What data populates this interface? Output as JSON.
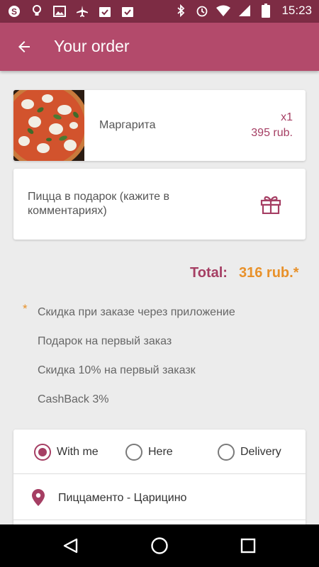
{
  "status_bar": {
    "time": "15:23",
    "left_icons": [
      "skype-icon",
      "lightbulb-icon",
      "image-icon",
      "airplane-icon",
      "checklist-icon",
      "checklist-icon"
    ],
    "right_icons": [
      "bluetooth-icon",
      "alarm-icon",
      "wifi-icon",
      "signal-icon",
      "battery-icon"
    ]
  },
  "app_bar": {
    "title": "Your order",
    "back_icon": "arrow-left-icon",
    "background": "#b34a6b"
  },
  "order_item": {
    "name": "Маргарита",
    "quantity": "x1",
    "price": "395 rub."
  },
  "gift": {
    "text": "Пицца в подарок (кажите в комментариях)",
    "icon": "gift-icon"
  },
  "total": {
    "label": "Total:",
    "value": "316 rub.*"
  },
  "notes": {
    "asterisk": "*",
    "items": [
      "Скидка при заказе через приложение",
      "Подарок на первый заказ",
      "Скидка 10% на первый заказк",
      "CashBack 3%"
    ]
  },
  "delivery": {
    "options": [
      {
        "label": "With me",
        "selected": true
      },
      {
        "label": "Here",
        "selected": false
      },
      {
        "label": "Delivery",
        "selected": false
      }
    ],
    "location": "Пиццаменто - Царицино"
  },
  "colors": {
    "accent": "#a53e63",
    "total_value": "#e8912a",
    "status_bar": "#7d2c44"
  }
}
